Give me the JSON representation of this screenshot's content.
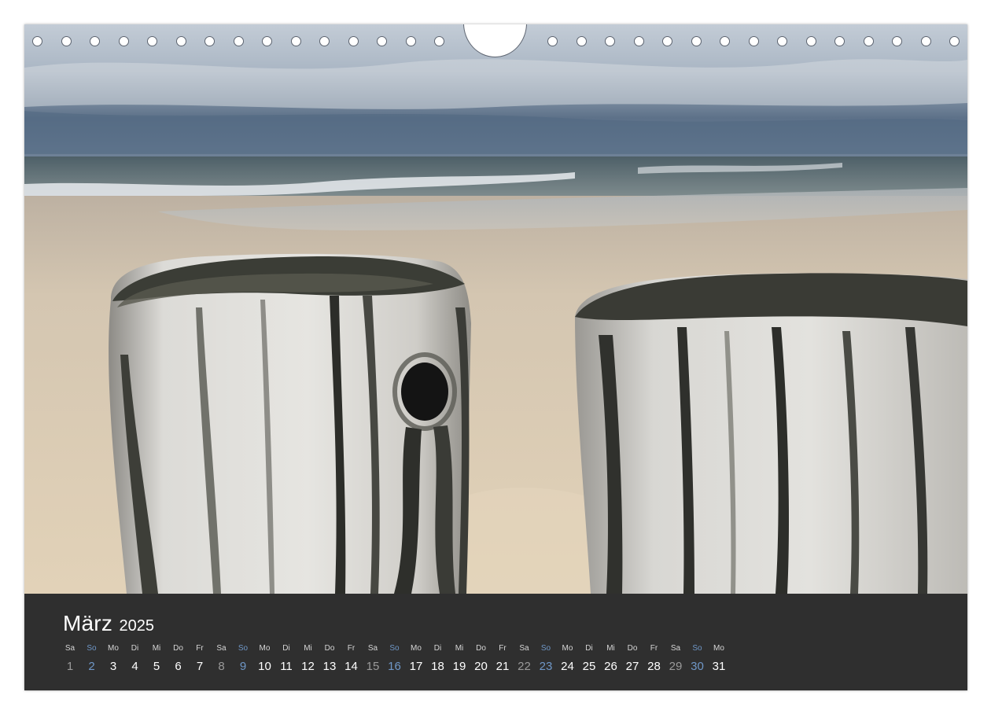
{
  "calendar": {
    "month": "März",
    "year": "2025",
    "days": [
      {
        "dow": "Sa",
        "num": "1",
        "kind": "sat"
      },
      {
        "dow": "So",
        "num": "2",
        "kind": "sun"
      },
      {
        "dow": "Mo",
        "num": "3",
        "kind": "wd"
      },
      {
        "dow": "Di",
        "num": "4",
        "kind": "wd"
      },
      {
        "dow": "Mi",
        "num": "5",
        "kind": "wd"
      },
      {
        "dow": "Do",
        "num": "6",
        "kind": "wd"
      },
      {
        "dow": "Fr",
        "num": "7",
        "kind": "wd"
      },
      {
        "dow": "Sa",
        "num": "8",
        "kind": "sat"
      },
      {
        "dow": "So",
        "num": "9",
        "kind": "sun"
      },
      {
        "dow": "Mo",
        "num": "10",
        "kind": "wd"
      },
      {
        "dow": "Di",
        "num": "11",
        "kind": "wd"
      },
      {
        "dow": "Mi",
        "num": "12",
        "kind": "wd"
      },
      {
        "dow": "Do",
        "num": "13",
        "kind": "wd"
      },
      {
        "dow": "Fr",
        "num": "14",
        "kind": "wd"
      },
      {
        "dow": "Sa",
        "num": "15",
        "kind": "sat"
      },
      {
        "dow": "So",
        "num": "16",
        "kind": "sun"
      },
      {
        "dow": "Mo",
        "num": "17",
        "kind": "wd"
      },
      {
        "dow": "Di",
        "num": "18",
        "kind": "wd"
      },
      {
        "dow": "Mi",
        "num": "19",
        "kind": "wd"
      },
      {
        "dow": "Do",
        "num": "20",
        "kind": "wd"
      },
      {
        "dow": "Fr",
        "num": "21",
        "kind": "wd"
      },
      {
        "dow": "Sa",
        "num": "22",
        "kind": "sat"
      },
      {
        "dow": "So",
        "num": "23",
        "kind": "sun"
      },
      {
        "dow": "Mo",
        "num": "24",
        "kind": "wd"
      },
      {
        "dow": "Di",
        "num": "25",
        "kind": "wd"
      },
      {
        "dow": "Mi",
        "num": "26",
        "kind": "wd"
      },
      {
        "dow": "Do",
        "num": "27",
        "kind": "wd"
      },
      {
        "dow": "Fr",
        "num": "28",
        "kind": "wd"
      },
      {
        "dow": "Sa",
        "num": "29",
        "kind": "sat"
      },
      {
        "dow": "So",
        "num": "30",
        "kind": "sun"
      },
      {
        "dow": "Mo",
        "num": "31",
        "kind": "wd"
      }
    ]
  },
  "colors": {
    "band": "#2f2f2f",
    "sunday": "#6f97c7",
    "saturday_number": "#9a9a9a",
    "weekday_number": "#ffffff"
  }
}
